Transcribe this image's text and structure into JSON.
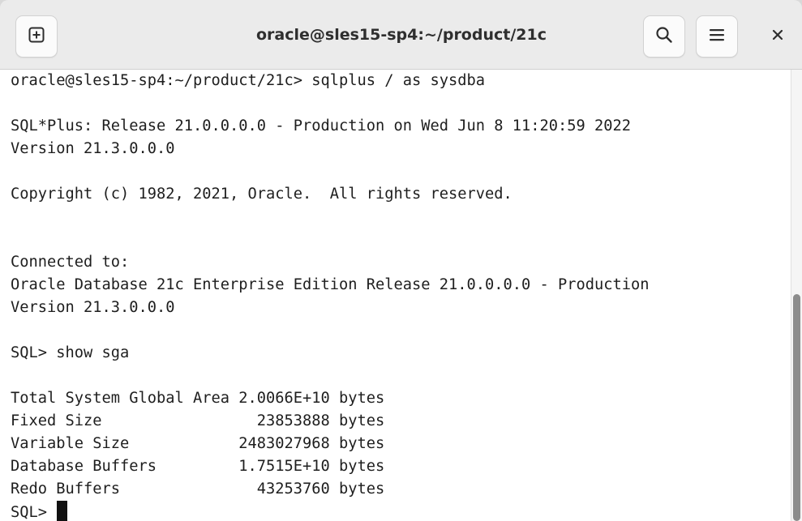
{
  "window": {
    "title": "oracle@sles15-sp4:~/product/21c"
  },
  "headerbar": {
    "new_tab_icon": "new-tab-plus-icon",
    "search_icon": "search-icon",
    "menu_icon": "hamburger-menu-icon",
    "close_icon": "close-icon",
    "close_glyph": "×"
  },
  "terminal": {
    "lines": [
      "oracle@sles15-sp4:~/product/21c> sqlplus / as sysdba",
      "",
      "SQL*Plus: Release 21.0.0.0.0 - Production on Wed Jun 8 11:20:59 2022",
      "Version 21.3.0.0.0",
      "",
      "Copyright (c) 1982, 2021, Oracle.  All rights reserved.",
      "",
      "",
      "Connected to:",
      "Oracle Database 21c Enterprise Edition Release 21.0.0.0.0 - Production",
      "Version 21.3.0.0.0",
      "",
      "SQL> show sga",
      "",
      "Total System Global Area 2.0066E+10 bytes",
      "Fixed Size                 23853888 bytes",
      "Variable Size            2483027968 bytes",
      "Database Buffers         1.7515E+10 bytes",
      "Redo Buffers               43253760 bytes"
    ],
    "prompt": "SQL> "
  },
  "colors": {
    "headerbar_bg": "#ebebeb",
    "terminal_bg": "#ffffff",
    "terminal_fg": "#1e1e1e",
    "scroll_thumb": "#8c8c8c"
  }
}
